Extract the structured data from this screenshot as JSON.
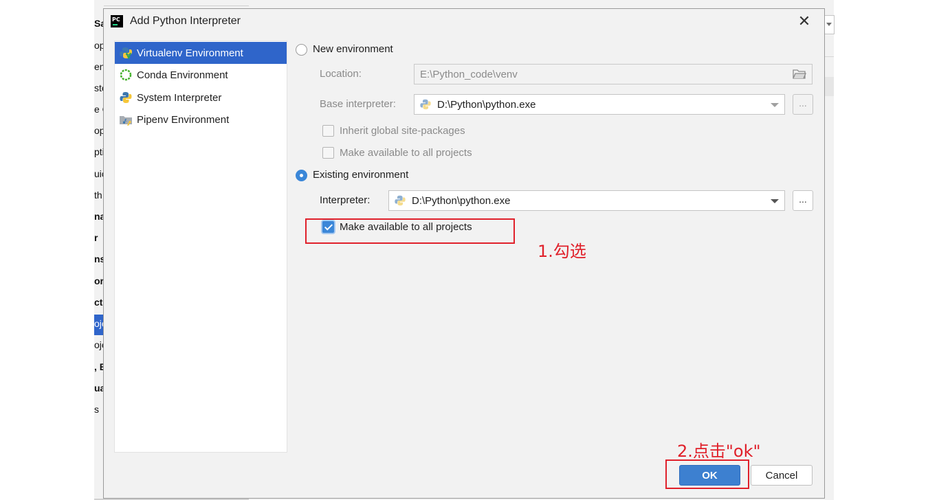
{
  "background": {
    "left_fragments": [
      {
        "text": "Sa",
        "bold": true
      },
      {
        "text": "op",
        "bold": false
      },
      {
        "text": "en",
        "bold": false
      },
      {
        "text": "ste",
        "bold": false
      },
      {
        "text": "e C",
        "bold": false
      },
      {
        "text": "op",
        "bold": false
      },
      {
        "text": "pti",
        "bold": false
      },
      {
        "text": "uic",
        "bold": false
      },
      {
        "text": "th",
        "bold": false
      },
      {
        "text": "na",
        "bold": true
      },
      {
        "text": "r",
        "bold": true
      },
      {
        "text": "ns",
        "bold": true
      },
      {
        "text": "or",
        "bold": true
      },
      {
        "text": "ct",
        "bold": true
      },
      {
        "text": "oje",
        "bold": false
      },
      {
        "text": "oje",
        "bold": false
      },
      {
        "text": ", E",
        "bold": true
      },
      {
        "text": "ua",
        "bold": true
      },
      {
        "text": "s",
        "bold": false
      }
    ]
  },
  "dialog": {
    "title": "Add Python Interpreter",
    "close_symbol": "✕",
    "environment_types": [
      {
        "label": "Virtualenv Environment",
        "icon": "virtualenv-icon",
        "selected": true
      },
      {
        "label": "Conda Environment",
        "icon": "conda-icon",
        "selected": false
      },
      {
        "label": "System Interpreter",
        "icon": "python-icon",
        "selected": false
      },
      {
        "label": "Pipenv Environment",
        "icon": "pipenv-icon",
        "selected": false
      }
    ],
    "new_env": {
      "radio_label": "New environment",
      "selected": false,
      "location_label": "Location:",
      "location_value": "E:\\Python_code\\venv",
      "base_interpreter_label": "Base interpreter:",
      "base_interpreter_value": "D:\\Python\\python.exe",
      "browse_label": "...",
      "inherit_label": "Inherit global site-packages",
      "inherit_checked": false,
      "make_available_label": "Make available to all projects",
      "make_available_checked": false
    },
    "existing_env": {
      "radio_label": "Existing environment",
      "selected": true,
      "interpreter_label": "Interpreter:",
      "interpreter_value": "D:\\Python\\python.exe",
      "browse_label": "...",
      "make_available_label": "Make available to all projects",
      "make_available_checked": true
    },
    "buttons": {
      "ok": "OK",
      "cancel": "Cancel"
    }
  },
  "annotations": {
    "step1": "1.勾选",
    "step2": "2.点击\"ok\""
  },
  "colors": {
    "selection": "#2f65ca",
    "accent": "#3b87d8",
    "annotation_red": "#e0202a",
    "primary_button": "#3d80d0"
  }
}
